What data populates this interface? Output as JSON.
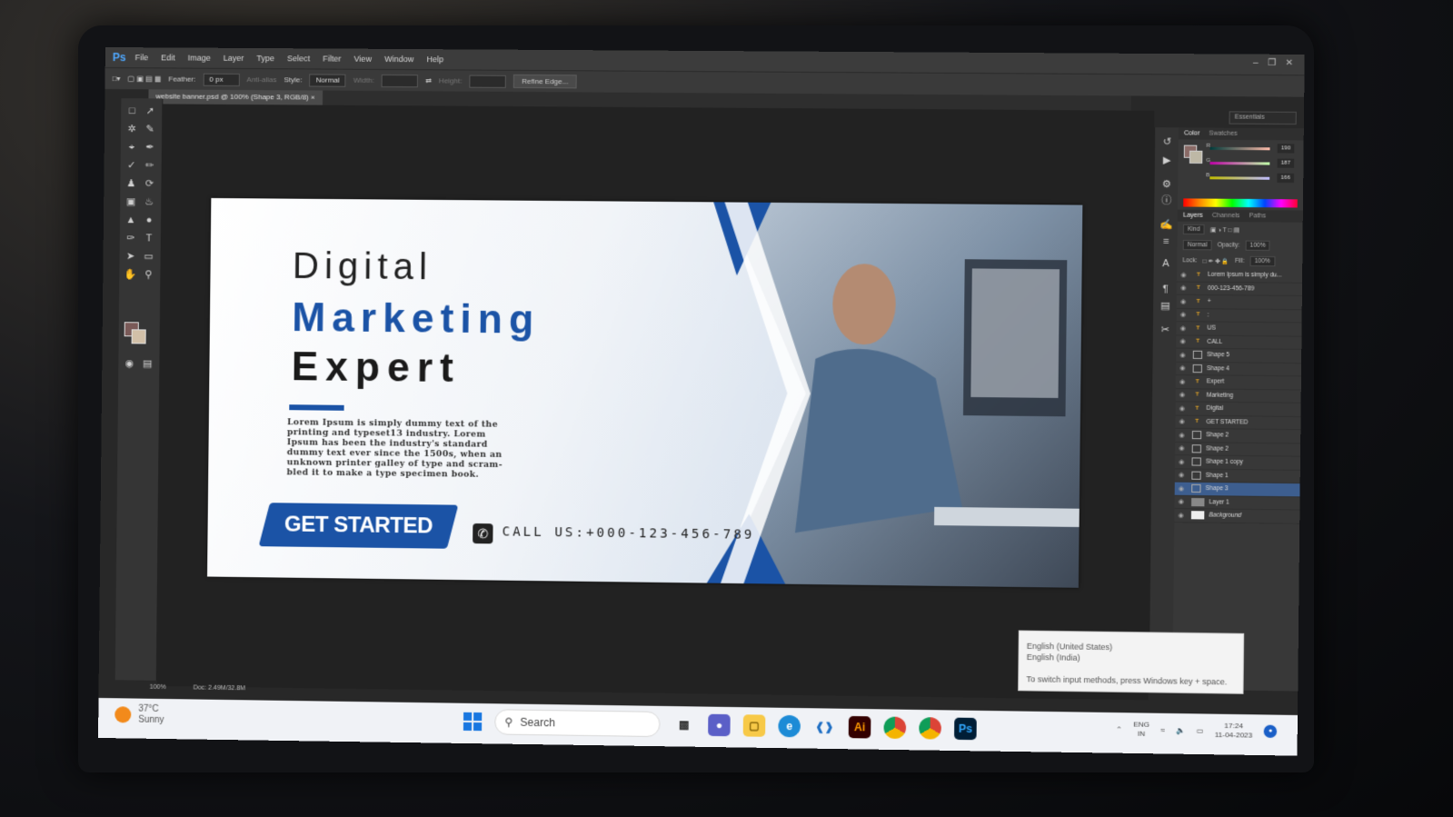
{
  "app": {
    "logo": "Ps"
  },
  "menu": [
    "File",
    "Edit",
    "Image",
    "Layer",
    "Type",
    "Select",
    "Filter",
    "View",
    "Window",
    "Help"
  ],
  "options": {
    "feather_label": "Feather:",
    "feather_value": "0 px",
    "antialias_label": "Anti-alias",
    "style_label": "Style:",
    "style_value": "Normal",
    "width_label": "Width:",
    "height_label": "Height:",
    "refine_edge": "Refine Edge..."
  },
  "workspace": "Essentials",
  "document_tab": "website banner.psd @ 100% (Shape 3, RGB/8)",
  "status": {
    "zoom": "100%",
    "doc": "Doc: 2.49M/32.8M"
  },
  "color_panel": {
    "tabs": [
      "Color",
      "Swatches"
    ],
    "r_label": "R",
    "g_label": "G",
    "b_label": "B",
    "r": "190",
    "g": "187",
    "b": "166"
  },
  "layers_panel": {
    "tabs": [
      "Layers",
      "Channels",
      "Paths"
    ],
    "kind": "Kind",
    "blend": "Normal",
    "opacity_label": "Opacity:",
    "opacity": "100%",
    "lock_label": "Lock:",
    "fill_label": "Fill:",
    "fill": "100%",
    "layers": [
      {
        "name": "Lorem Ipsum is simply du...",
        "kind": "text"
      },
      {
        "name": "000-123-456-789",
        "kind": "text"
      },
      {
        "name": "+",
        "kind": "text"
      },
      {
        "name": ":",
        "kind": "text"
      },
      {
        "name": "US",
        "kind": "text"
      },
      {
        "name": "CALL",
        "kind": "text"
      },
      {
        "name": "Shape 5",
        "kind": "shape"
      },
      {
        "name": "Shape 4",
        "kind": "shape"
      },
      {
        "name": "Expert",
        "kind": "text"
      },
      {
        "name": "Marketing",
        "kind": "text"
      },
      {
        "name": "Digital",
        "kind": "text"
      },
      {
        "name": "GET STARTED",
        "kind": "text"
      },
      {
        "name": "Shape 2",
        "kind": "shape"
      },
      {
        "name": "Shape 2",
        "kind": "shape"
      },
      {
        "name": "Shape 1 copy",
        "kind": "shape"
      },
      {
        "name": "Shape 1",
        "kind": "shape"
      },
      {
        "name": "Shape 3",
        "kind": "shape",
        "selected": true
      },
      {
        "name": "Layer 1",
        "kind": "image"
      },
      {
        "name": "Background",
        "kind": "background"
      }
    ]
  },
  "banner": {
    "line1": "Digital",
    "line2": "Marketing",
    "line3": "Expert",
    "body": "Lorem Ipsum is simply dummy text of the printing and typeset13 industry. Lorem Ipsum has been the industry's standard dummy text ever since the 1500s, when an unknown printer galley of type and scram-bled it to make a type specimen book.",
    "button": "GET STARTED",
    "call": "CALL US:+000-123-456-789",
    "accent": "#1b53a6"
  },
  "tooltip": {
    "line1": "English (United States)",
    "line2": "English (India)",
    "line3": "To switch input methods, press Windows key + space."
  },
  "taskbar": {
    "temp": "37°C",
    "condition": "Sunny",
    "search": "Search",
    "lang1": "ENG",
    "lang2": "IN",
    "time": "17:24",
    "date": "11-04-2023"
  }
}
